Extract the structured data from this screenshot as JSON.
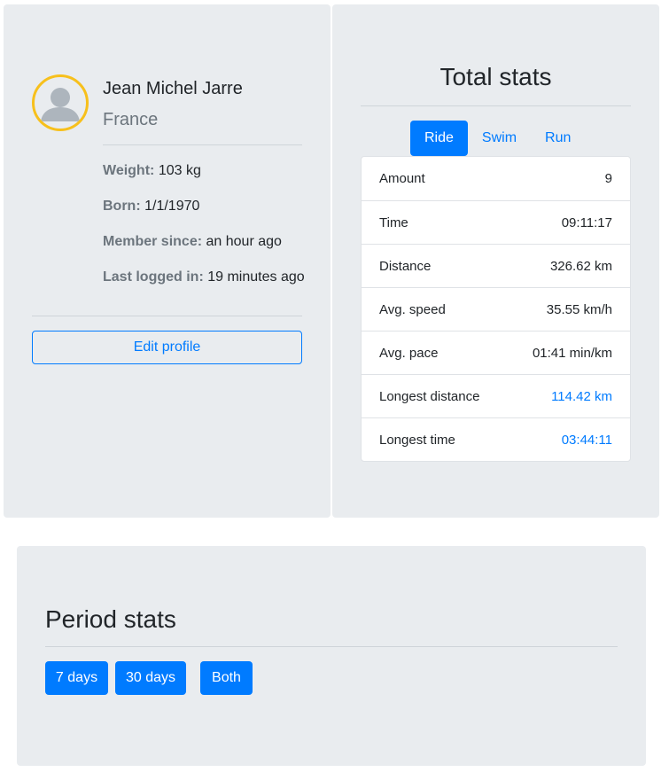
{
  "profile": {
    "name": "Jean Michel Jarre",
    "country": "France",
    "weight_label": "Weight:",
    "weight_value": "103 kg",
    "born_label": "Born:",
    "born_value": "1/1/1970",
    "member_label": "Member since:",
    "member_value": "an hour ago",
    "last_label": "Last logged in:",
    "last_value": "19 minutes ago",
    "edit_label": "Edit profile",
    "avatar_border_color": "#f7c01c"
  },
  "total": {
    "title": "Total stats",
    "tabs": [
      {
        "label": "Ride",
        "active": true
      },
      {
        "label": "Swim",
        "active": false
      },
      {
        "label": "Run",
        "active": false
      }
    ],
    "rows": [
      {
        "label": "Amount",
        "value": "9"
      },
      {
        "label": "Time",
        "value": "09:11:17"
      },
      {
        "label": "Distance",
        "value": "326.62 km"
      },
      {
        "label": "Avg. speed",
        "value": "35.55 km/h"
      },
      {
        "label": "Avg. pace",
        "value": "01:41 min/km"
      },
      {
        "label": "Longest distance",
        "value": "114.42 km"
      },
      {
        "label": "Longest time",
        "value": "03:44:11"
      }
    ]
  },
  "period": {
    "title": "Period stats",
    "buttons": [
      {
        "label": "7 days"
      },
      {
        "label": "30 days"
      },
      {
        "label": "Both"
      }
    ]
  },
  "colors": {
    "accent": "#007bff",
    "panel_bg": "#e9ecef",
    "muted": "#6c757d"
  }
}
